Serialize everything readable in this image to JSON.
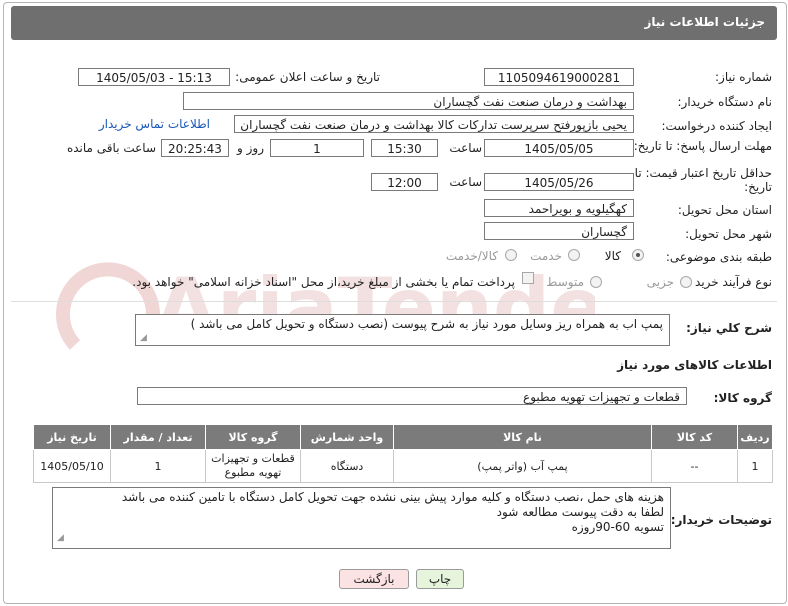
{
  "page": {
    "title": "جزئیات اطلاعات نیاز"
  },
  "fields": {
    "need_number_label": "شماره نیاز:",
    "need_number": "1105094619000281",
    "announce_label": "تاریخ و ساعت اعلان عمومی:",
    "announce_value": "1405/05/03 - 15:13",
    "buyer_org_label": "نام دستگاه خریدار:",
    "buyer_org": "بهداشت و درمان صنعت نفت گچساران",
    "creator_label": "ایجاد کننده درخواست:",
    "creator": "یحیی بازپورفتح سرپرست تدارکات کالا  بهداشت و درمان صنعت نفت گچساران",
    "contact_link": "اطلاعات تماس خریدار",
    "deadline_label": "مهلت ارسال پاسخ: تا تاریخ:",
    "deadline_date": "1405/05/05",
    "time_label": "ساعت",
    "deadline_time": "15:30",
    "days_value": "1",
    "days_label": "روز و",
    "remaining_time": "20:25:43",
    "remaining_label": "ساعت باقی مانده",
    "price_validity_label": "حداقل تاریخ اعتبار قیمت: تا تاریخ:",
    "price_date": "1405/05/26",
    "time_label2": "ساعت",
    "price_time": "12:00",
    "province_label": "استان محل تحویل:",
    "province": "کهگیلویه و بویراحمد",
    "city_label": "شهر محل تحویل:",
    "city": "گچساران",
    "category_label": "طبقه بندی موضوعی:",
    "cat_goods": "کالا",
    "cat_service": "خدمت",
    "cat_goods_service": "کالا/خدمت",
    "process_label": "نوع فرآیند خرید :",
    "proc_partial": "جزیی",
    "proc_medium": "متوسط",
    "payment_note": "پرداخت تمام یا بخشی از مبلغ خرید،از محل \"اسناد خزانه اسلامی\" خواهد بود.",
    "description_label": "شرح کلي نياز:",
    "description": "پمپ اب به همراه ریز وسایل مورد نیاز به شرح پیوست (نصب دستگاه و تحویل کامل می باشد )",
    "goods_info_title": "اطلاعات کالاهای مورد نیاز",
    "goods_group_label": "گروه کالا:",
    "goods_group": "قطعات و تجهیزات تهویه مطبوع",
    "buyer_notes_label": "توضیحات خریدار:",
    "buyer_notes_1": "هزینه های حمل ،نصب دستگاه و کلیه موارد پیش بینی نشده جهت تحویل کامل دستگاه با تامین کننده می باشد",
    "buyer_notes_2": "لطفا به  دقت پیوست مطالعه شود",
    "buyer_notes_3": "تسویه 60-90روزه"
  },
  "table": {
    "headers": [
      "ردیف",
      "کد کالا",
      "نام کالا",
      "واحد شمارش",
      "گروه کالا",
      "تعداد / مقدار",
      "تاریخ نیاز"
    ],
    "rows": [
      [
        "1",
        "--",
        "پمپ آب (واتر پمپ)",
        "دستگاه",
        "قطعات و تجهیزات تهویه مطبوع",
        "1",
        "1405/05/10"
      ]
    ]
  },
  "buttons": {
    "print": "چاپ",
    "back": "بازگشت"
  },
  "colors": {
    "titlebar": "#6f6f6f",
    "table_header": "#7b7b7b",
    "print_btn": "#e6f4dc",
    "back_btn": "#fbe3e3",
    "link": "#1a57b8"
  },
  "watermark_text": "AriaTender.net"
}
